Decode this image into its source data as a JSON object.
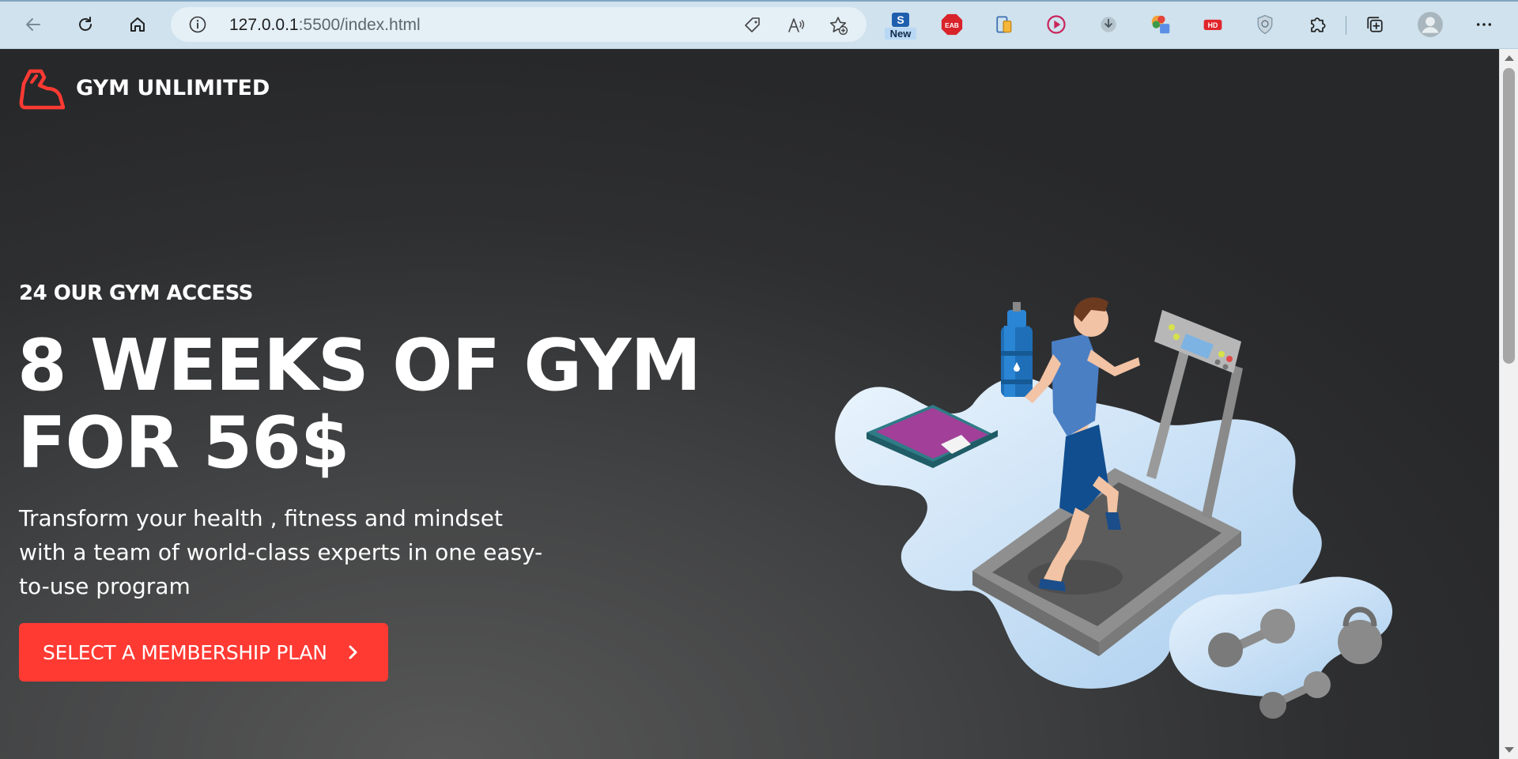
{
  "browser": {
    "url_host": "127.0.0.1",
    "url_path": ":5500/index.html",
    "icons": {
      "back": "back-arrow-icon",
      "refresh": "refresh-icon",
      "home": "home-icon",
      "info": "info-icon",
      "tag": "tag-icon",
      "read_aloud": "read-aloud-icon",
      "favorite": "favorite-add-icon",
      "extensions": "puzzle-icon",
      "collections": "collections-icon",
      "profile": "profile-icon",
      "more": "more-icon"
    },
    "extensions": {
      "new_label": "New",
      "new_letter": "S",
      "eab_label": "EAB",
      "hd_label": "HD"
    }
  },
  "site": {
    "brand_name": "GYM UNLIMITED",
    "eyebrow": "24 OUR GYM ACCESS",
    "headline_line1": "8 WEEKS OF GYM",
    "headline_line2": "FOR 56$",
    "subtext": "Transform your health , fitness and mindset with a team of world-class experts in one easy-to-use program",
    "cta_label": "SELECT A MEMBERSHIP PLAN"
  },
  "colors": {
    "accent": "#ff3a33",
    "background": "#2f3032",
    "chrome": "#cfe2ee"
  }
}
